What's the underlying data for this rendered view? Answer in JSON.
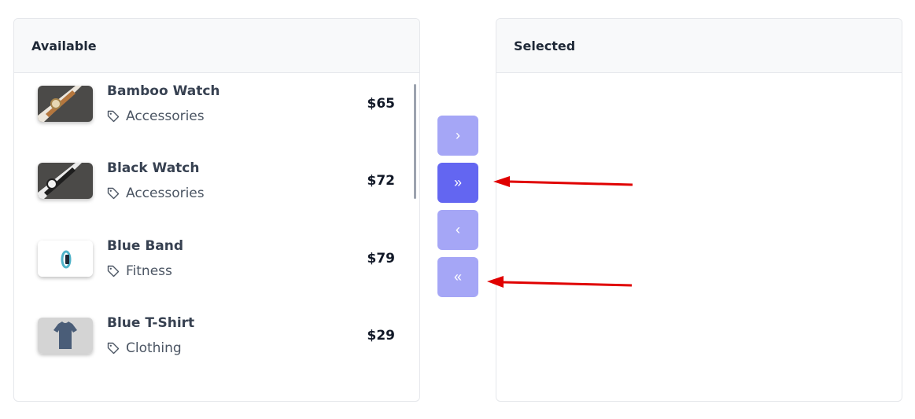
{
  "available": {
    "title": "Available",
    "items": [
      {
        "name": "Bamboo Watch",
        "category": "Accessories",
        "price": "$65"
      },
      {
        "name": "Black Watch",
        "category": "Accessories",
        "price": "$72"
      },
      {
        "name": "Blue Band",
        "category": "Fitness",
        "price": "$79"
      },
      {
        "name": "Blue T-Shirt",
        "category": "Clothing",
        "price": "$29"
      }
    ]
  },
  "selected": {
    "title": "Selected"
  },
  "controls": {
    "move_to_selected": "›",
    "move_all_to_selected": "»",
    "move_to_available": "‹",
    "move_all_to_available": "«"
  },
  "icons": {
    "tag": "tag-icon"
  },
  "colors": {
    "button": "#a5a6f6",
    "button_active": "#6366f1",
    "annotation_arrow": "#e00000"
  }
}
